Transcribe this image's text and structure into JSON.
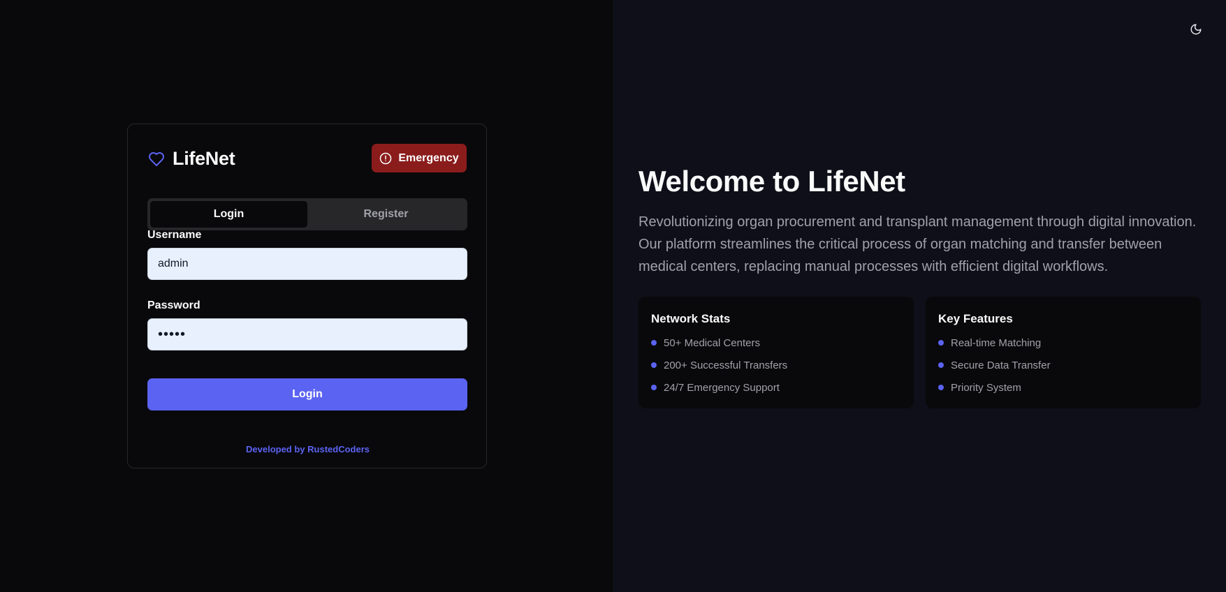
{
  "brand": {
    "name": "LifeNet",
    "icon": "heart-icon"
  },
  "emergency": {
    "label": "Emergency",
    "icon": "alert-circle-icon"
  },
  "tabs": [
    {
      "label": "Login",
      "active": true
    },
    {
      "label": "Register",
      "active": false
    }
  ],
  "form": {
    "username_label": "Username",
    "username_value": "admin",
    "password_label": "Password",
    "password_value": "•••••",
    "submit_label": "Login"
  },
  "footer": {
    "credit": "Developed by RustedCoders"
  },
  "theme_toggle": {
    "icon": "moon-icon"
  },
  "hero": {
    "title": "Welcome to LifeNet",
    "description": "Revolutionizing organ procurement and transplant management through digital innovation. Our platform streamlines the critical process of organ matching and transfer between medical centers, replacing manual processes with efficient digital workflows."
  },
  "stats_card": {
    "title": "Network Stats",
    "items": [
      "50+ Medical Centers",
      "200+ Successful Transfers",
      "24/7 Emergency Support"
    ]
  },
  "features_card": {
    "title": "Key Features",
    "items": [
      "Real-time Matching",
      "Secure Data Transfer",
      "Priority System"
    ]
  },
  "colors": {
    "accent": "#5b63f2",
    "emergency": "#8b1c1c",
    "left_bg": "#09090b",
    "right_bg": "#0e0f18"
  }
}
